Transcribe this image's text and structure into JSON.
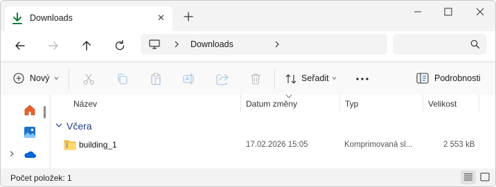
{
  "window": {
    "tab_title": "Downloads",
    "tab_close_glyph": "✕",
    "controls": [
      "minimize-icon",
      "maximize-icon",
      "close-icon"
    ]
  },
  "navigation": {
    "buttons": [
      "back-arrow-icon",
      "forward-arrow-icon",
      "up-arrow-icon",
      "refresh-icon"
    ],
    "breadcrumb": [
      "Downloads"
    ],
    "search_placeholder": ""
  },
  "commandbar": {
    "new_label": "Nový",
    "actions": [
      "cut-icon",
      "copy-icon",
      "paste-icon",
      "rename-icon",
      "share-icon",
      "delete-icon"
    ],
    "sort_label": "Seřadit",
    "more_glyph": "•••",
    "details_label": "Podrobnosti"
  },
  "sidebar": {
    "items": [
      "home-icon",
      "gallery-icon",
      "onedrive-icon"
    ]
  },
  "list": {
    "columns": [
      "Název",
      "Datum změny",
      "Typ",
      "Velikost"
    ],
    "groups": [
      {
        "label": "Včera",
        "rows": [
          {
            "name": "building_1",
            "modified": "17.02.2026 15:05",
            "type": "Komprimovaná sl...",
            "size": "2 553 kB"
          }
        ]
      }
    ]
  },
  "status": {
    "item_count": "Počet položek: 1",
    "active_view": "details"
  },
  "colors": {
    "accent": "#0f7b3c",
    "group_header": "#1f3c88",
    "onedrive": "#0a64d6",
    "home": "#e8612c",
    "zip_folder": "#f5c243"
  }
}
